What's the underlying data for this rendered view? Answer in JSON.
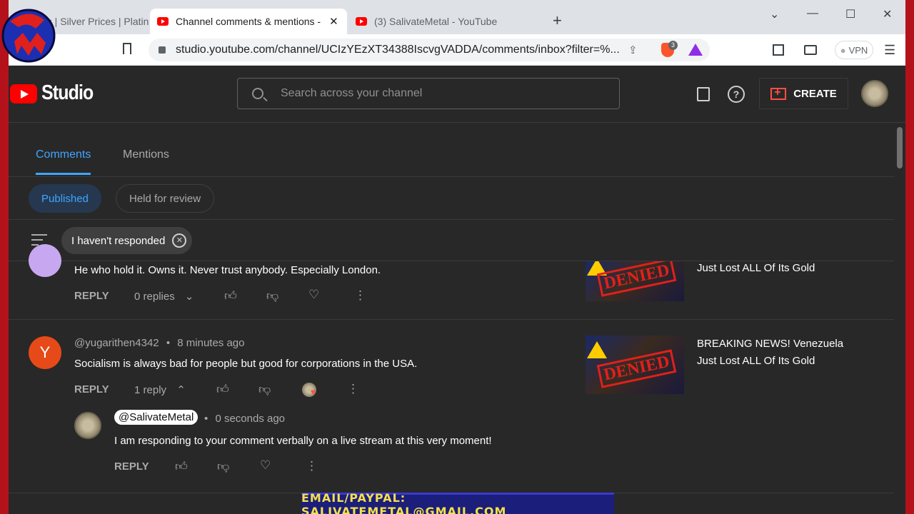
{
  "browser": {
    "tabs": [
      {
        "label": "es | Silver Prices | Platin",
        "active": false
      },
      {
        "label": "Channel comments & mentions -",
        "active": true
      },
      {
        "label": "(3) SalivateMetal - YouTube",
        "active": false
      }
    ],
    "url": "studio.youtube.com/channel/UCIzYEzXT34388IscvgVADDA/comments/inbox?filter=%...",
    "vpn_label": "VPN",
    "brave_badge": "3"
  },
  "studio": {
    "logo_text": "Studio",
    "search_placeholder": "Search across your channel",
    "create_label": "CREATE"
  },
  "tabs": [
    {
      "label": "Comments",
      "active": true
    },
    {
      "label": "Mentions",
      "active": false
    }
  ],
  "chips": [
    {
      "label": "Published",
      "selected": true
    },
    {
      "label": "Held for review",
      "selected": false
    }
  ],
  "filter": {
    "label": "I haven't responded"
  },
  "comments": [
    {
      "text": "He who hold it. Owns it. Never trust anybody. Especially London.",
      "reply_label": "REPLY",
      "replies_label": "0 replies",
      "video_title": "Just Lost ALL Of Its Gold"
    },
    {
      "avatar_letter": "Y",
      "author": "@yugarithen4342",
      "time": "8 minutes ago",
      "text": "Socialism is always bad for people but good for corporations in the USA.",
      "reply_label": "REPLY",
      "replies_label": "1 reply",
      "video_title_line1": "BREAKING NEWS! Venezuela",
      "video_title_line2": "Just Lost ALL Of Its Gold"
    }
  ],
  "reply": {
    "author": "@SalivateMetal",
    "time": "0 seconds ago",
    "text": "I am responding to your comment verbally on a live stream at this very moment!",
    "reply_label": "REPLY"
  },
  "thumbnail_text": "DENIED",
  "banner": {
    "text": "EMAIL/PAYPAL: SALIVATEMETAL@GMAIL.COM"
  },
  "colors": {
    "accent": "#3ea6ff",
    "brand_red": "#ff0000",
    "frame_red": "#b3121b"
  }
}
